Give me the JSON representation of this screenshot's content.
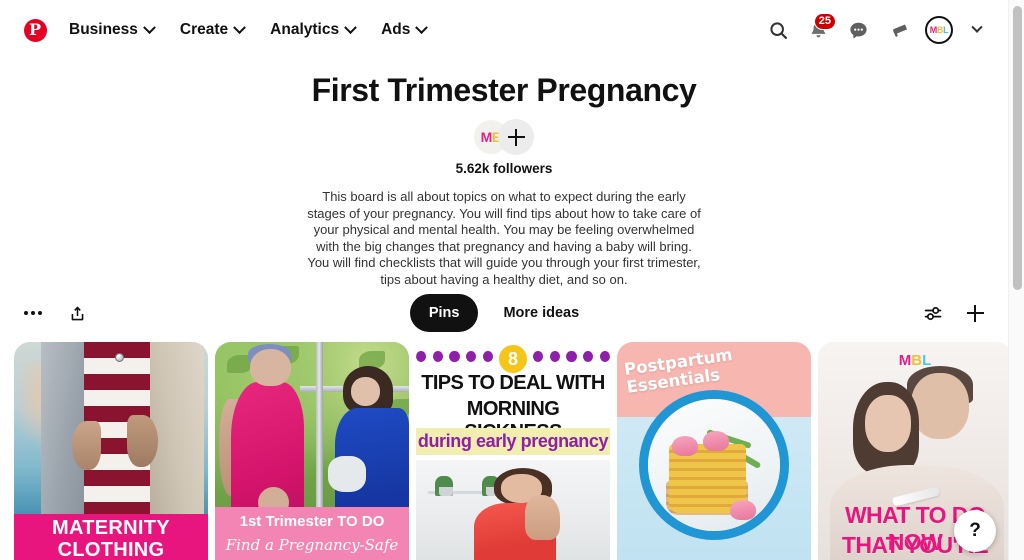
{
  "header": {
    "logo": "pinterest-logo",
    "nav": [
      {
        "label": "Business",
        "icon": "chevron-down-icon"
      },
      {
        "label": "Create",
        "icon": "chevron-down-icon"
      },
      {
        "label": "Analytics",
        "icon": "chevron-down-icon"
      },
      {
        "label": "Ads",
        "icon": "chevron-down-icon"
      }
    ],
    "actions": {
      "search_icon": "search-icon",
      "notifications_icon": "bell-icon",
      "notifications_count": "25",
      "messages_icon": "chat-bubble-icon",
      "announcements_icon": "megaphone-icon",
      "account_chevron": "chevron-down-icon"
    },
    "avatar": {
      "initial1": "M",
      "initial2": "B",
      "initial3": "L"
    }
  },
  "board": {
    "title": "First Trimester Pregnancy",
    "collaborator_avatar": {
      "initial1": "M",
      "initial2": "B"
    },
    "add_collaborator_icon": "plus-icon",
    "followers": "5.62k followers",
    "description": "This board is all about topics on what to expect during the early stages of your pregnancy. You will find tips about how to take care of your physical and mental health. You may be feeling overwhelmed with the big changes that pregnancy and having a baby will bring. You will find checklists that will guide you through your first trimester, tips about having a healthy diet, and so on."
  },
  "toolbar": {
    "more_options_icon": "ellipsis-icon",
    "share_icon": "share-upload-icon",
    "tabs": [
      {
        "label": "Pins",
        "active": true
      },
      {
        "label": "More ideas",
        "active": false
      }
    ],
    "filter_icon": "sliders-icon",
    "create_icon": "plus-icon"
  },
  "pins": [
    {
      "name": "maternity-clothing",
      "overlay_line1": "MATERNITY",
      "overlay_line2": "CLOTHING",
      "banner_color": "#e8157f"
    },
    {
      "name": "first-trimester-to-do",
      "overlay_line1": "1st Trimester TO DO",
      "overlay_line2": "Find a Pregnancy-Safe",
      "banner_color": "#f285b4"
    },
    {
      "name": "morning-sickness-tips",
      "badge_number": "8",
      "overlay_line1": "TIPS TO DEAL WITH",
      "overlay_line2": "MORNING SICKNESS",
      "overlay_line3": "during early pregnancy",
      "accent_color": "#8e1fa8",
      "badge_color": "#f5c518",
      "highlight_color": "#f2eeb0"
    },
    {
      "name": "postpartum-essentials",
      "overlay_line1": "Postpartum",
      "overlay_line2": "Essentials",
      "accent_color": "#2196d4"
    },
    {
      "name": "what-to-do-now",
      "logo_m": "M",
      "logo_b": "B",
      "logo_l": "L",
      "overlay_line1": "WHAT TO DO NOW",
      "overlay_line2": "THAT YOU'RE",
      "accent_color": "#e8157f"
    }
  ],
  "help": {
    "label": "?"
  },
  "colors": {
    "brand_red": "#e60023",
    "badge_red": "#cc0000",
    "active_tab_bg": "#111111",
    "pink": "#e8157f"
  }
}
